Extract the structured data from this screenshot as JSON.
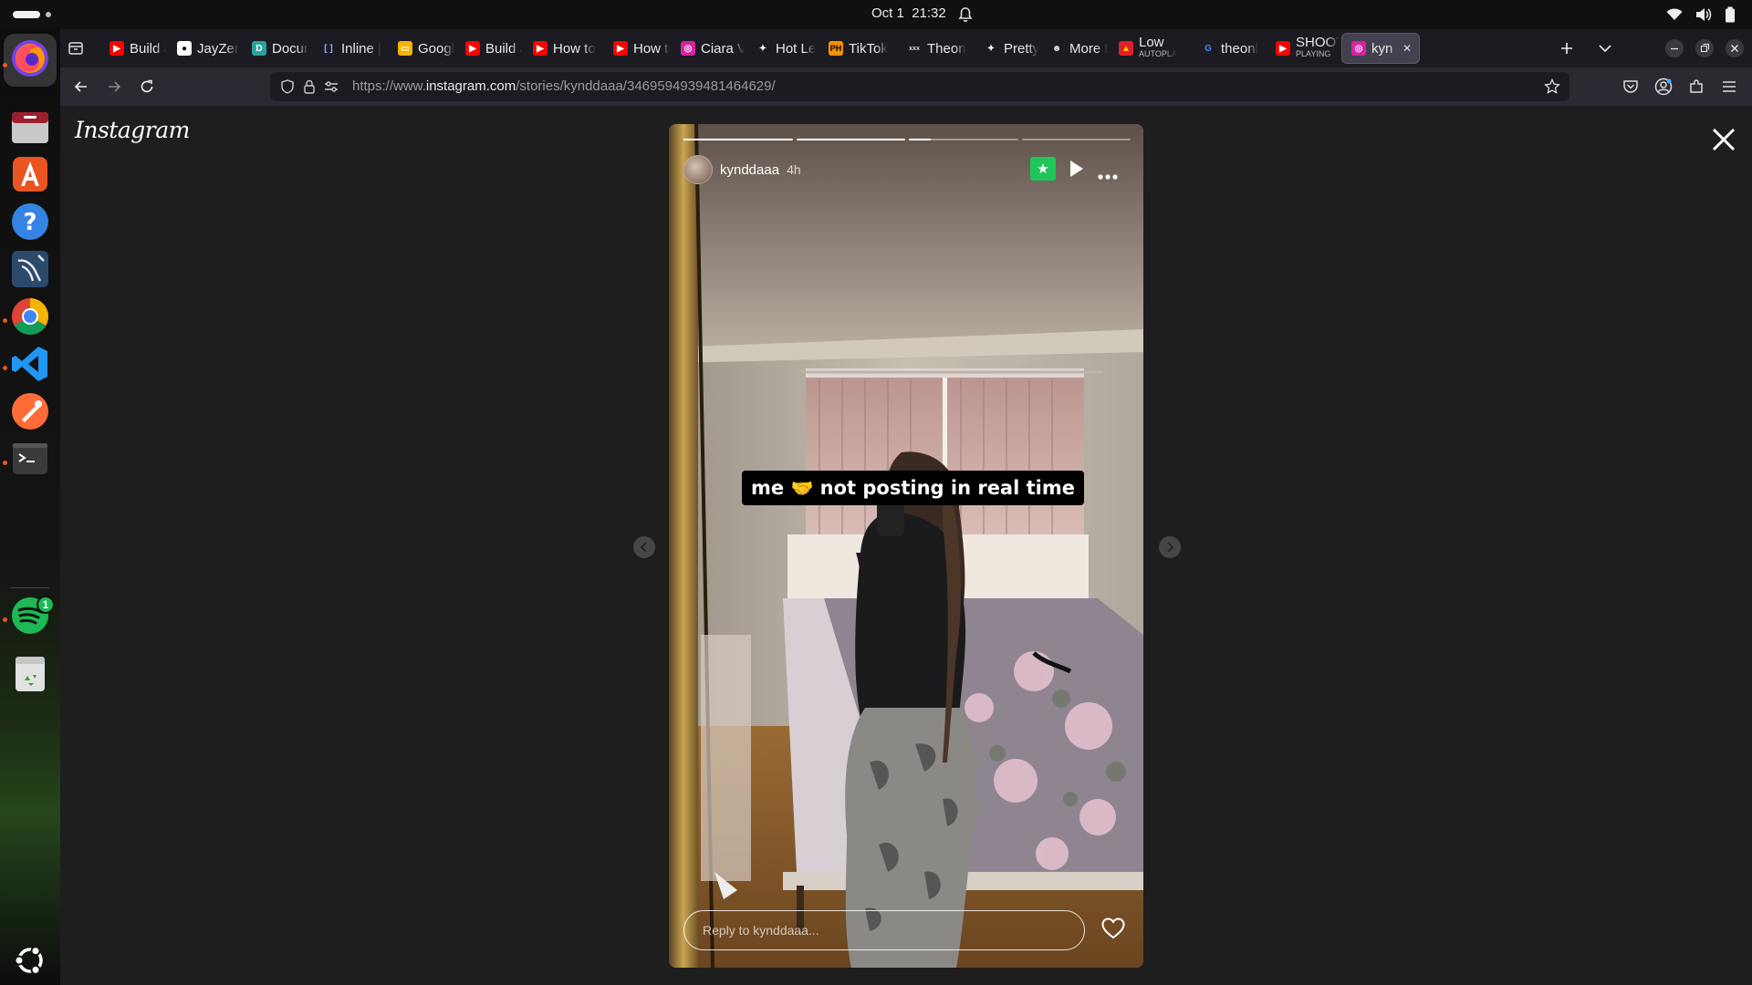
{
  "system": {
    "date": "Oct 1",
    "time": "21:32"
  },
  "dock": {
    "apps": [
      "Firefox",
      "Files",
      "App Center",
      "Help",
      "Jellyfish Client",
      "Google Chrome",
      "Visual Studio Code",
      "Postman",
      "Terminal",
      "Spotify",
      "Trash",
      "Show Apps"
    ],
    "spotify_badge": "1"
  },
  "browser": {
    "tabs": [
      {
        "title": "Build a",
        "icon": "youtube-icon"
      },
      {
        "title": "JayZen",
        "icon": "github-icon"
      },
      {
        "title": "Docum",
        "icon": "docs-icon"
      },
      {
        "title": "Inline |",
        "icon": "inline-icon"
      },
      {
        "title": "Google",
        "icon": "google-slides-icon"
      },
      {
        "title": "Build a",
        "icon": "youtube-icon"
      },
      {
        "title": "How to",
        "icon": "youtube-icon"
      },
      {
        "title": "How to",
        "icon": "youtube-icon"
      },
      {
        "title": "Ciara V",
        "icon": "instagram-icon"
      },
      {
        "title": "Hot Le",
        "icon": "figure-icon"
      },
      {
        "title": "TikTok",
        "icon": "ph-icon",
        "badge": "PH"
      },
      {
        "title": "Theon",
        "icon": "xxx-icon",
        "badge": "xxx"
      },
      {
        "title": "Pretty",
        "icon": "figure-icon"
      },
      {
        "title": "More L",
        "icon": "mask-icon"
      },
      {
        "title": "Low",
        "subtitle": "AUTOPLA",
        "icon": "flame-icon"
      },
      {
        "title": "theonl",
        "icon": "google-icon"
      },
      {
        "title": "SHOOT",
        "subtitle": "PLAYING",
        "icon": "youtube-icon"
      },
      {
        "title": "kyn (",
        "icon": "instagram-icon",
        "active": true
      }
    ],
    "url_prefix": "https://www.",
    "url_domain": "instagram.com",
    "url_path": "/stories/kynddaaa/3469594939481464629/"
  },
  "instagram": {
    "logo": "Instagram",
    "story": {
      "username": "kynddaaa",
      "time_ago": "4h",
      "caption_before": "me",
      "caption_emoji": "🤝",
      "caption_after": "not posting in real time",
      "reply_placeholder": "Reply to kynddaaa...",
      "progress_segments": [
        1,
        1,
        0.2,
        0
      ],
      "close_friends_color": "#20c659"
    }
  }
}
